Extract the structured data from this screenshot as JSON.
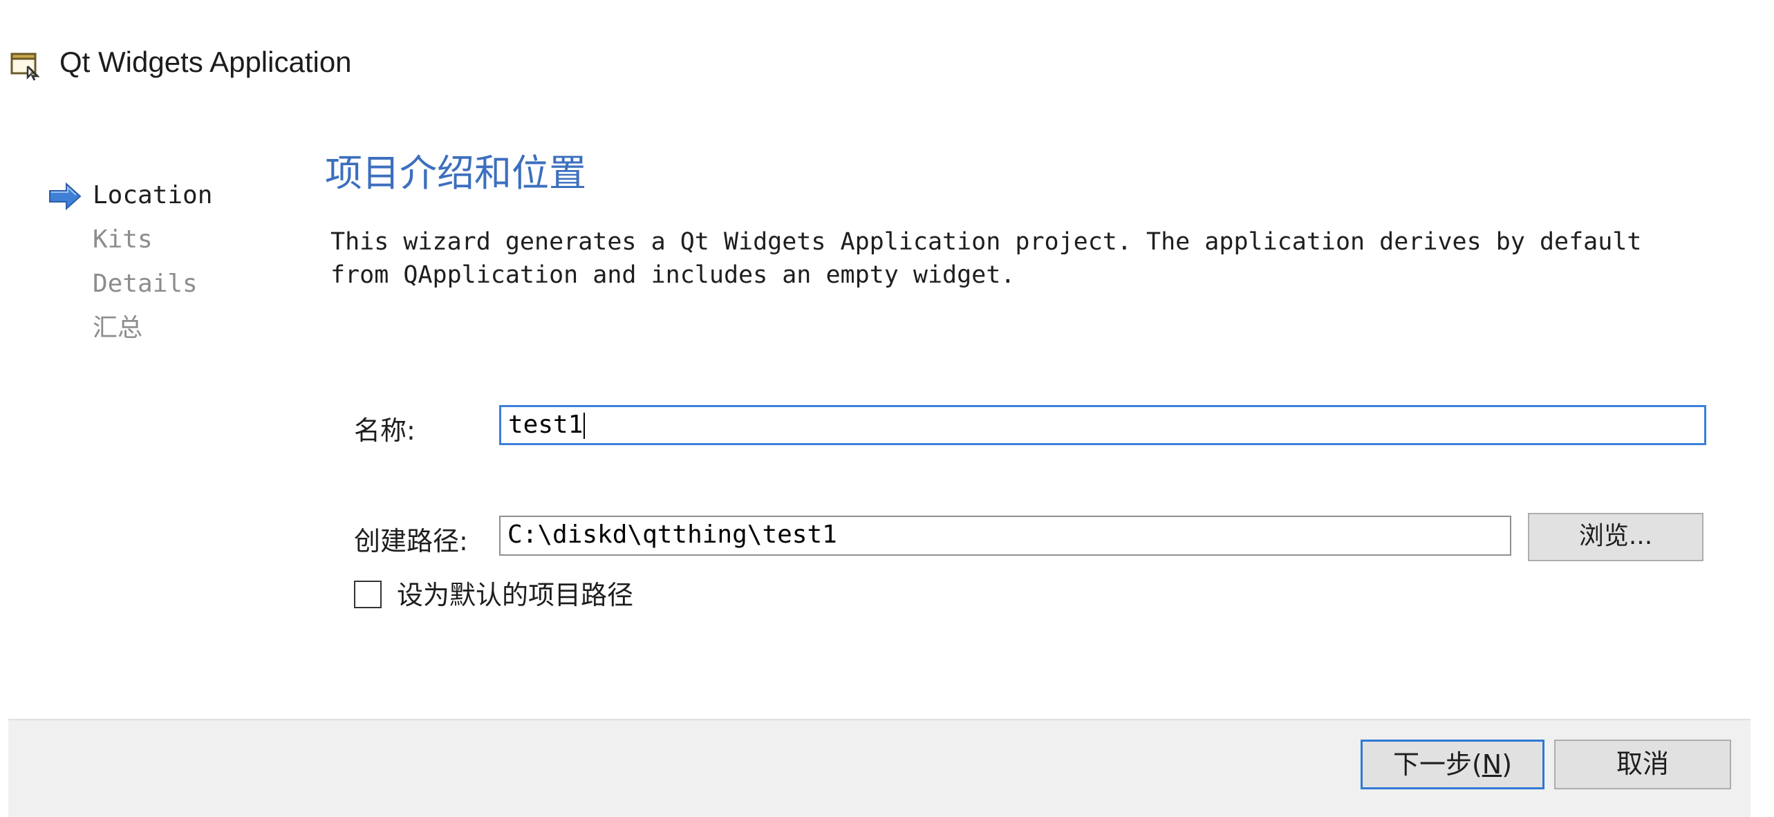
{
  "window": {
    "title": "Qt Widgets Application",
    "icon": "window-icon"
  },
  "steps": [
    {
      "label": "Location",
      "active": true,
      "icon": "arrow-right-icon"
    },
    {
      "label": "Kits",
      "active": false
    },
    {
      "label": "Details",
      "active": false
    },
    {
      "label": "汇总",
      "active": false
    }
  ],
  "page": {
    "title": "项目介绍和位置",
    "description_line1": "This wizard generates a Qt Widgets Application project. The application derives by default",
    "description_line2": "from QApplication and includes an empty widget."
  },
  "form": {
    "name_label": "名称:",
    "name_value": "test1",
    "path_label": "创建路径:",
    "path_value": "C:\\diskd\\qtthing\\test1",
    "browse_label": "浏览...",
    "default_path_label": "设为默认的项目路径",
    "default_path_checked": false
  },
  "footer": {
    "next_label_prefix": "下一步(",
    "next_mnemonic": "N",
    "next_label_suffix": ")",
    "cancel_label": "取消"
  },
  "colors": {
    "page_title": "#3c6fbe",
    "focus_border": "#3b7fd8",
    "arrow_fill": "#3f7fd6",
    "inactive_text": "#8d8d8d"
  }
}
